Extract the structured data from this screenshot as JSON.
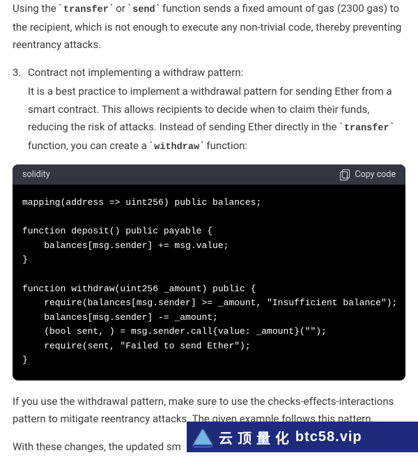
{
  "intro": {
    "seg1": "Using the ",
    "code1": "transfer",
    "seg2": " or ",
    "code2": "send",
    "seg3": " function sends a fixed amount of gas (2300 gas) to the recipient, which is not enough to execute any non-trivial code, thereby preventing reentrancy attacks."
  },
  "list_item": {
    "title": "Contract not implementing a withdraw pattern:",
    "body_seg1": "It is a best practice to implement a withdrawal pattern for sending Ether from a smart contract. This allows recipients to decide when to claim their funds, reducing the risk of attacks. Instead of sending Ether directly in the ",
    "body_code1": "transfer",
    "body_seg2": " function, you can create a ",
    "body_code2": "withdraw",
    "body_seg3": " function:"
  },
  "code": {
    "language": "solidity",
    "copy_label": "Copy code",
    "content": "mapping(address => uint256) public balances;\n\nfunction deposit() public payable {\n    balances[msg.sender] += msg.value;\n}\n\nfunction withdraw(uint256 _amount) public {\n    require(balances[msg.sender] >= _amount, \"Insufficient balance\");\n    balances[msg.sender] -= _amount;\n    (bool sent, ) = msg.sender.call{value: _amount}(\"\");\n    require(sent, \"Failed to send Ether\");\n}"
  },
  "outro1": "If you use the withdrawal pattern, make sure to use the checks-effects-interactions pattern to mitigate reentrancy attacks. The given example follows this pattern.",
  "outro2_prefix": "With these changes, the updated sm",
  "banner": {
    "cn": "云 顶 量 化",
    "latin": "btc58.vip"
  }
}
